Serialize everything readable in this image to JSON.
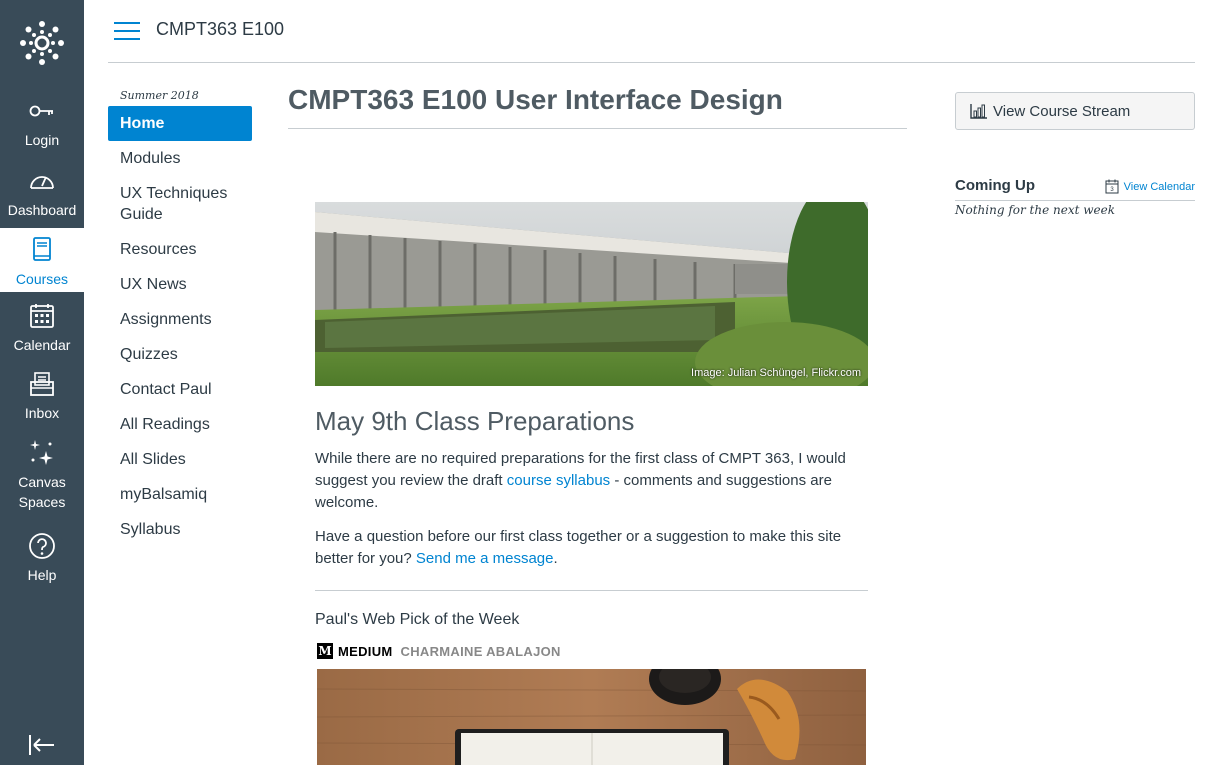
{
  "global_nav": {
    "items": [
      {
        "label": "Login",
        "icon": "key-icon"
      },
      {
        "label": "Dashboard",
        "icon": "dashboard-icon"
      },
      {
        "label": "Courses",
        "icon": "book-icon"
      },
      {
        "label": "Calendar",
        "icon": "calendar-icon"
      },
      {
        "label": "Inbox",
        "icon": "inbox-icon"
      },
      {
        "label": "Canvas",
        "label2": "Spaces",
        "icon": "sparkle-icon"
      },
      {
        "label": "Help",
        "icon": "help-icon"
      }
    ],
    "active": "Courses"
  },
  "header": {
    "breadcrumb": "CMPT363 E100"
  },
  "course_nav": {
    "term": "Summer 2018",
    "items": [
      {
        "label": "Home"
      },
      {
        "label": "Modules"
      },
      {
        "label": "UX Techniques",
        "label2": "Guide"
      },
      {
        "label": "Resources"
      },
      {
        "label": "UX News"
      },
      {
        "label": "Assignments"
      },
      {
        "label": "Quizzes"
      },
      {
        "label": "Contact Paul"
      },
      {
        "label": "All Readings"
      },
      {
        "label": "All Slides"
      },
      {
        "label": "myBalsamiq"
      },
      {
        "label": "Syllabus"
      }
    ],
    "active": "Home"
  },
  "main": {
    "title": "CMPT363 E100 User Interface Design",
    "image_credit": "Image: Julian Schüngel, Flickr.com",
    "heading": "May 9th Class Preparations",
    "p1_a": "While there are no required preparations for the first class of CMPT 363, I would suggest you review the draft ",
    "p1_link": "course syllabus",
    "p1_b": " - comments and suggestions are welcome.",
    "p2_a": "Have a question before our first class together or a suggestion to make this site better for you? ",
    "p2_link": "Send me a message",
    "p2_b": ".",
    "pick_title": "Paul's Web Pick of the Week",
    "medium_logo": "M",
    "medium_brand": "MEDIUM",
    "medium_author": "CHARMAINE ABALAJON"
  },
  "sidebar": {
    "stream_button": "View Course Stream",
    "coming_up": "Coming Up",
    "view_calendar": "View Calendar",
    "nothing": "Nothing for the next week"
  },
  "colors": {
    "nav_bg": "#394b58",
    "accent": "#0084d1",
    "text": "#2d3b45"
  }
}
